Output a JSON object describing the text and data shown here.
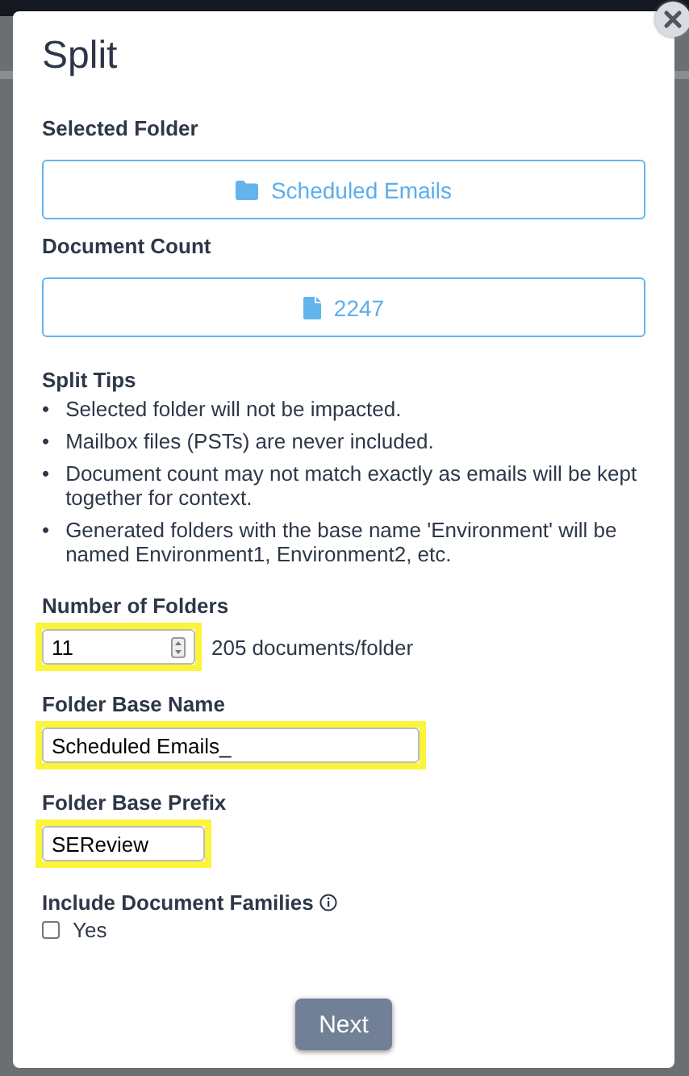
{
  "dialog": {
    "title": "Split",
    "selected_folder": {
      "label": "Selected Folder",
      "value": "Scheduled Emails"
    },
    "document_count": {
      "label": "Document Count",
      "value": "2247"
    },
    "tips": {
      "label": "Split Tips",
      "items": [
        {
          "bullet": "•",
          "text": "Selected folder will not be impacted."
        },
        {
          "bullet": "•",
          "text": "Mailbox files (PSTs) are never included."
        },
        {
          "bullet": "•",
          "text": "Document count may not match exactly as emails will be kept together for context."
        },
        {
          "bullet": "•",
          "text": "Generated folders with the base name 'Environment' will be named Environment1, Environment2, etc."
        }
      ]
    },
    "number_of_folders": {
      "label": "Number of Folders",
      "value": "11",
      "highlighted": true,
      "hint": "205 documents/folder"
    },
    "folder_base_name": {
      "label": "Folder Base Name",
      "value": "Scheduled Emails_",
      "highlighted": true
    },
    "folder_base_prefix": {
      "label": "Folder Base Prefix",
      "value": "SEReview",
      "highlighted": true
    },
    "include_document_families": {
      "label": "Include Document Families",
      "option": "Yes",
      "checked": false
    },
    "next_button": "Next"
  }
}
